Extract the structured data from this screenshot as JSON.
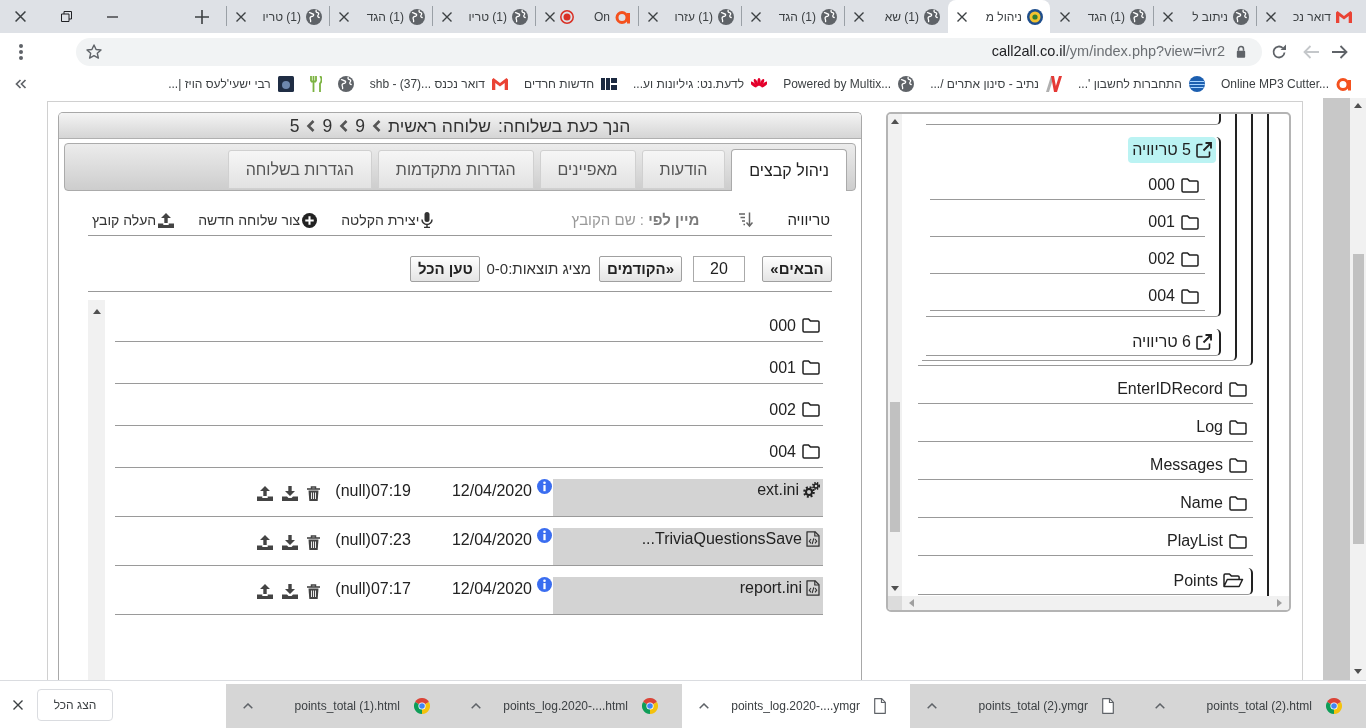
{
  "browser": {
    "tabs": [
      {
        "title": "דואר נכ",
        "kind": "mail",
        "selected": false,
        "audio": false
      },
      {
        "title": "ניתוב ל",
        "kind": "site",
        "selected": false,
        "audio": false
      },
      {
        "title": "(1) הגד",
        "kind": "site",
        "selected": false,
        "audio": false
      },
      {
        "title": "ניהול מ",
        "kind": "app",
        "selected": true,
        "audio": false
      },
      {
        "title": "(1) שא",
        "kind": "site",
        "selected": false,
        "audio": false
      },
      {
        "title": "(1) הגד",
        "kind": "site",
        "selected": false,
        "audio": false
      },
      {
        "title": "(1) עזרו",
        "kind": "site",
        "selected": false,
        "audio": false
      },
      {
        "title": "On",
        "kind": "media",
        "selected": false,
        "audio": true
      },
      {
        "title": "(1) טריו",
        "kind": "site",
        "selected": false,
        "audio": false
      },
      {
        "title": "(1) הגד",
        "kind": "site",
        "selected": false,
        "audio": false
      },
      {
        "title": "(1) טריו",
        "kind": "site",
        "selected": false,
        "audio": false
      }
    ],
    "nav": {
      "forward_disabled": true
    },
    "address": {
      "host": "call2all.co.il",
      "path": "/ym/index.php?view=ivr2"
    },
    "bookmarks": [
      {
        "label": "Online MP3 Cutter...",
        "kind": "cutter"
      },
      {
        "label": "התחברות לחשבון '...",
        "kind": "login"
      },
      {
        "label": "נתיב - סינון אתרים /...",
        "kind": "filter"
      },
      {
        "label": "Powered by Multix...",
        "kind": "site"
      },
      {
        "label": "לדעת.נט: גיליונות וע...",
        "kind": "wiki"
      },
      {
        "label": "חדשות חרדים",
        "kind": "news"
      },
      {
        "label": "דואר נכנס ...shb - (37)",
        "kind": "mail"
      },
      {
        "kind": "site"
      },
      {
        "kind": "food"
      },
      {
        "label": "רבי ישעי'לעס הויז |...",
        "kind": "channel"
      }
    ]
  },
  "page": {
    "breadcrumb": {
      "label": "הנך כעת בשלוחה:",
      "path": [
        "שלוחה ראשית",
        "9",
        "9",
        "5"
      ]
    },
    "tabs": [
      {
        "label": "ניהול קבצים",
        "selected": true
      },
      {
        "label": "הודעות",
        "selected": false
      },
      {
        "label": "מאפיינים",
        "selected": false
      },
      {
        "label": "הגדרות מתקדמות",
        "selected": false
      },
      {
        "label": "הגדרות בשלוחה",
        "selected": false
      }
    ],
    "toolbar": {
      "title": "טריוויה",
      "sort": "**מיין לפי** : שם הקובץ",
      "actions": [
        {
          "kind": "record",
          "label": "יצירת הקלטה"
        },
        {
          "kind": "new",
          "label": "צור שלוחה חדשה"
        },
        {
          "kind": "upload",
          "label": "העלה קובץ"
        }
      ]
    },
    "pager": {
      "next": "הבאים»",
      "page_size": "20",
      "prev": "«הקודמים",
      "summary": "מציג תוצאות:0-0",
      "load_all": "טען הכל"
    },
    "files": [
      {
        "kind": "folder",
        "name": "000"
      },
      {
        "kind": "folder",
        "name": "001"
      },
      {
        "kind": "folder",
        "name": "002"
      },
      {
        "kind": "folder",
        "name": "004"
      },
      {
        "kind": "settings",
        "name": "ext.ini",
        "date": "12/04/2020",
        "time": "07:19(null)"
      },
      {
        "kind": "code",
        "name": "TriviaQuestionsSave...",
        "date": "12/04/2020",
        "time": "07:23(null)"
      },
      {
        "kind": "code",
        "name": "report.ini",
        "date": "12/04/2020",
        "time": "07:17(null)"
      }
    ]
  },
  "tree": [
    {
      "children": [
        {
          "children": [
            {
              "kind": "extension",
              "label": "5 טריוויה",
              "selected": true,
              "children": [
                {
                  "kind": "folder",
                  "label": "000",
                  "selected": false,
                  "expanded": false
                },
                {
                  "kind": "folder",
                  "label": "001",
                  "selected": false,
                  "expanded": false
                },
                {
                  "kind": "folder",
                  "label": "002",
                  "selected": false,
                  "expanded": false
                },
                {
                  "kind": "folder",
                  "label": "004",
                  "selected": false,
                  "expanded": false
                }
              ]
            },
            {
              "kind": "extension",
              "label": "6 טריוויה",
              "selected": false
            }
          ]
        }
      ]
    },
    {
      "kind": "folder",
      "label": "EnterIDRecord",
      "selected": false,
      "expanded": false
    },
    {
      "kind": "folder",
      "label": "Log",
      "selected": false,
      "expanded": false
    },
    {
      "kind": "folder",
      "label": "Messages",
      "selected": false,
      "expanded": false
    },
    {
      "kind": "folder",
      "label": "Name",
      "selected": false,
      "expanded": false
    },
    {
      "kind": "folder",
      "label": "PlayList",
      "selected": false,
      "expanded": false
    },
    {
      "kind": "folder",
      "label": "Points",
      "selected": false,
      "expanded": true
    }
  ],
  "downloads": {
    "items": [
      {
        "name": "points_total (2).html",
        "kind": "page",
        "highlighted": true
      },
      {
        "name": "points_total (2).ymgr",
        "kind": "file",
        "highlighted": true
      },
      {
        "name": "points_log.2020-....ymgr",
        "kind": "file",
        "highlighted": false
      },
      {
        "name": "points_log.2020-....html",
        "kind": "page",
        "highlighted": true
      },
      {
        "name": "points_total (1).html",
        "kind": "page",
        "highlighted": true
      }
    ],
    "show_all": "הצג הכל"
  }
}
